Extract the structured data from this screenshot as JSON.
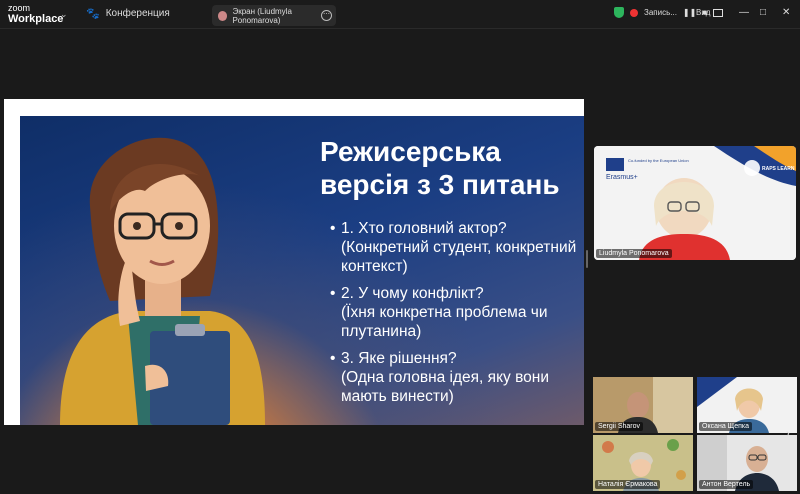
{
  "app": {
    "logo_line1": "zoom",
    "logo_line2": "Workplace"
  },
  "header": {
    "meeting_title": "Конференция",
    "screen_tab": "Экран (Liudmyla Ponomarova)",
    "recording_label": "Запись...",
    "view_label": "Вид"
  },
  "slide": {
    "title_line1": "Режисерська",
    "title_line2": "версія з 3 питань",
    "bullets": [
      {
        "head": "1. Хто головний актор?",
        "sub": "(Конкретний студент, конкретний контекст)"
      },
      {
        "head": "2. У чому конфлікт?",
        "sub": "(Їхня конкретна проблема чи плутанина)"
      },
      {
        "head": "3. Яке рішення?",
        "sub": "(Одна головна ідея, яку вони мають винести)"
      }
    ]
  },
  "participants": {
    "main": {
      "name": "Liudmyla Ponomarova",
      "banner_text": "Co-funded by the European Union",
      "program": "Erasmus+",
      "brand": "RAPS LEARN"
    },
    "grid": [
      {
        "name": "Sergii Sharov"
      },
      {
        "name": "Оксана Щепка"
      },
      {
        "name": "Наталія Єрмакова"
      },
      {
        "name": "Антон Вертель"
      }
    ]
  }
}
